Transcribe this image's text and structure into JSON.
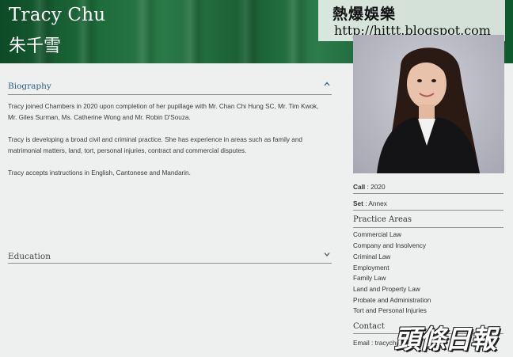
{
  "header": {
    "name_en": "Tracy Chu",
    "name_zh": "朱千雪"
  },
  "watermark": {
    "site_cn": "熱爆娛樂",
    "site_url": "http://hittt.blogspot.com",
    "paper_logo": "頭條日報"
  },
  "biography": {
    "title": "Biography",
    "paragraphs": [
      "Tracy joined Chambers in 2020 upon completion of her pupillage with Mr. Chan Chi Hung SC, Mr. Tim Kwok, Mr. Giles Surman, Ms. Catherine Wong and Mr. Robin D'Souza.",
      "Tracy is developing a broad civil and criminal practice. She has experience in areas such as family and matrimonial matters, land, tort, personal injuries, contract and commercial disputes.",
      "Tracy accepts instructions in English, Cantonese and Mandarin."
    ]
  },
  "education": {
    "title": "Education"
  },
  "sidebar": {
    "call_label": "Call",
    "call_value": ": 2020",
    "set_label": "Set",
    "set_value": ": Annex",
    "practice_title": "Practice Areas",
    "practice_areas": [
      "Commercial Law",
      "Company and Insolvency",
      "Criminal Law",
      "Employment",
      "Family Law",
      "Land and Property Law",
      "Probate and Administration",
      "Tort and Personal Injuries"
    ],
    "contact_title": "Contact",
    "email_text": "Email : tracychu@..."
  },
  "colors": {
    "header_green": "#1a5e34",
    "accent_blue": "#2a5f86",
    "page_bg": "#eef0ef"
  },
  "icons": {
    "bio_toggle": "chevron-up-icon",
    "edu_toggle": "chevron-down-icon"
  }
}
